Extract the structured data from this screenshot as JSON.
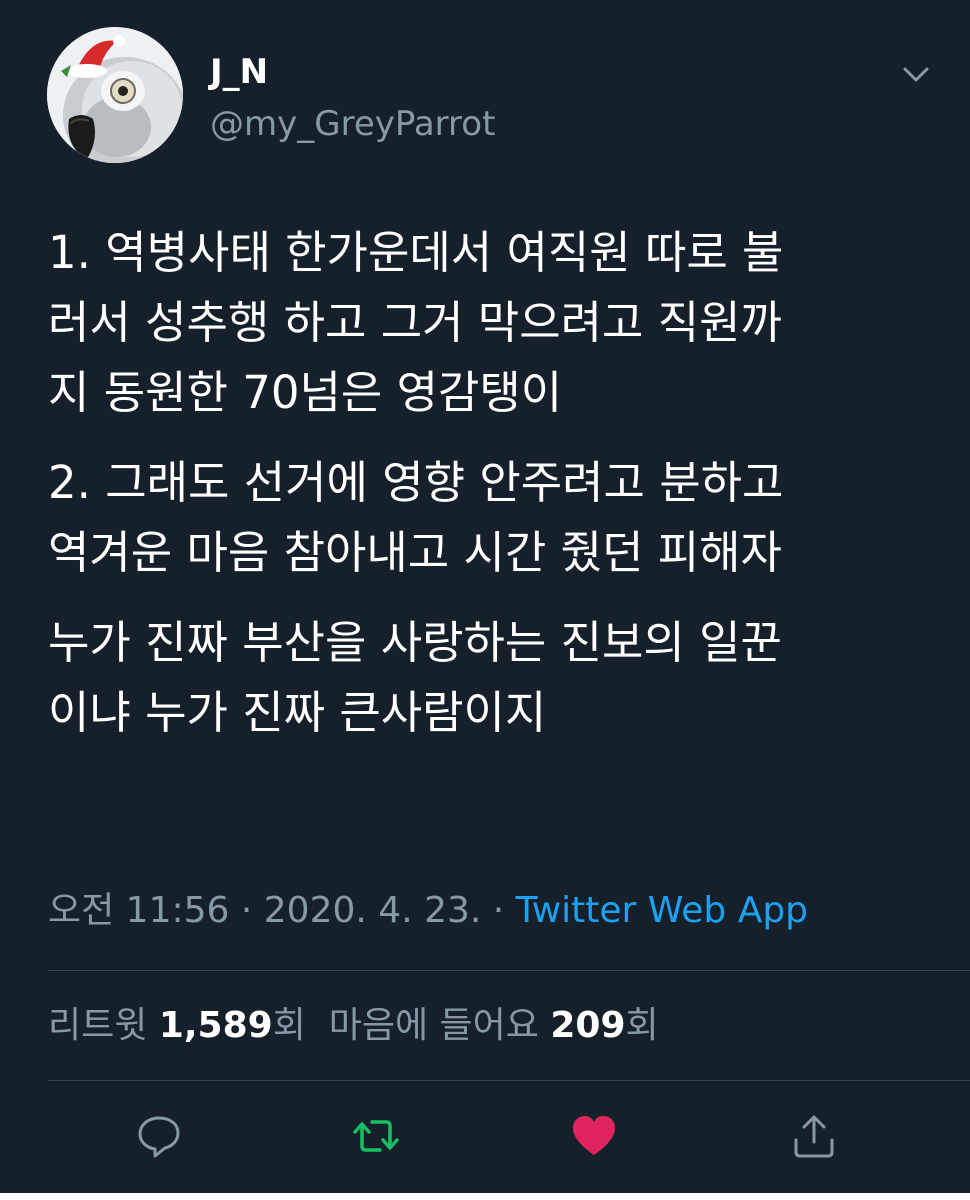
{
  "user": {
    "name": "J_N",
    "handle": "@my_GreyParrot"
  },
  "tweet": {
    "paragraphs": [
      "1. 역병사태 한가운데서 여직원 따로 불\n러서 성추행 하고 그거 막으려고 직원까\n지 동원한 70넘은 영감탱이",
      "2. 그래도 선거에 영향 안주려고 분하고\n역겨운 마음 참아내고 시간 줬던 피해자",
      "누가 진짜 부산을 사랑하는 진보의 일꾼\n이냐 누가 진짜 큰사람이지"
    ],
    "time": "오전 11:56",
    "separator": " · ",
    "date": "2020. 4. 23.",
    "source": "Twitter Web App"
  },
  "stats": {
    "retweets_label": "리트윗",
    "retweets_count": "1,589",
    "retweets_suffix": "회",
    "likes_label": "마음에 들어요",
    "likes_count": "209",
    "likes_suffix": "회"
  },
  "icons": {
    "menu": "chevron-down-icon",
    "reply": "reply-icon",
    "retweet": "retweet-icon",
    "like": "heart-icon",
    "share": "share-icon"
  },
  "colors": {
    "background": "#15202b",
    "secondary_text": "#8899a6",
    "link": "#1da1f2",
    "retweet_active": "#17bf63",
    "like_active": "#e0245e",
    "divider": "#38444d"
  }
}
